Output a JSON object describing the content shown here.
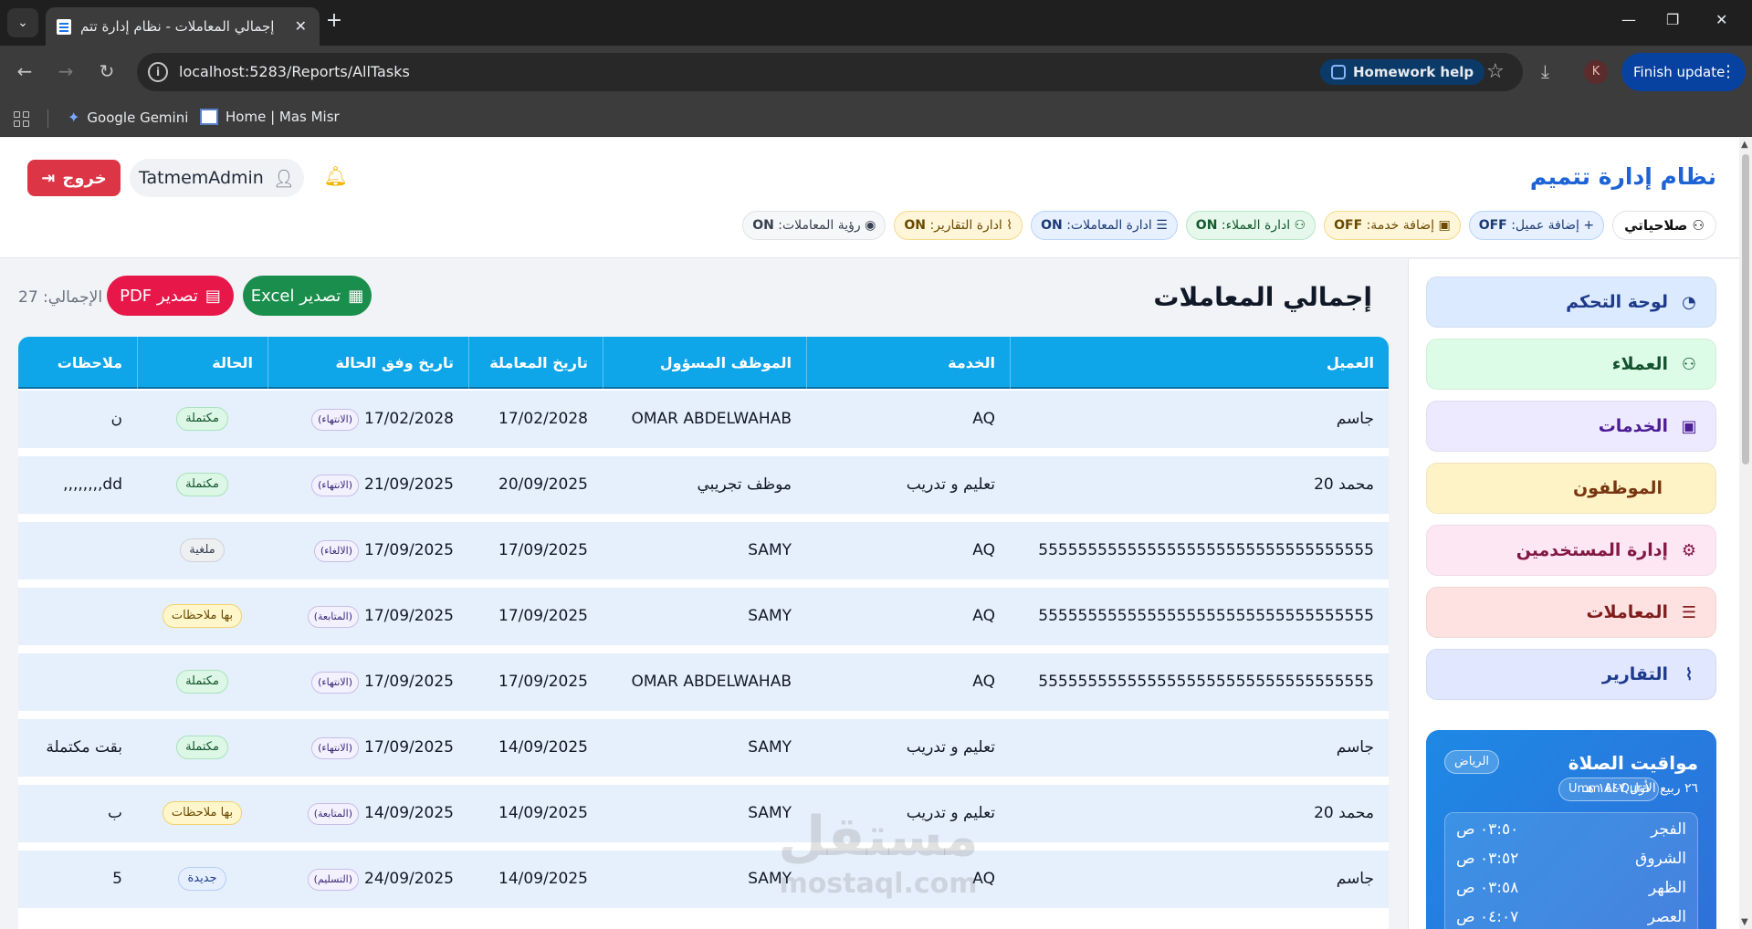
{
  "browser": {
    "tab_title": "إجمالي المعاملات - نظام إدارة تتم",
    "url": "localhost:5283/Reports/AllTasks",
    "homework_help": "Homework help",
    "profile_initial": "K",
    "finish_update": "Finish update",
    "bookmarks": [
      "Google Gemini",
      "Home | Mas Misr"
    ]
  },
  "header": {
    "brand": "نظام إدارة تتميم",
    "logout": "خروج",
    "username": "TatmemAdmin",
    "permissions_label": "صلاحياتي",
    "permissions": [
      {
        "label": "إضافة عميل:",
        "value": "OFF",
        "tone": "blue",
        "icon": "user-plus-icon",
        "glyph": "+"
      },
      {
        "label": "إضافة خدمة:",
        "value": "OFF",
        "tone": "yellow",
        "icon": "briefcase-icon",
        "glyph": "▣"
      },
      {
        "label": "ادارة العملاء:",
        "value": "ON",
        "tone": "green",
        "icon": "users-gear-icon",
        "glyph": "⚇"
      },
      {
        "label": "ادارة المعاملات:",
        "value": "ON",
        "tone": "blue",
        "icon": "list-check-icon",
        "glyph": "☰"
      },
      {
        "label": "ادارة التقارير:",
        "value": "ON",
        "tone": "yellow",
        "icon": "chart-line-icon",
        "glyph": "⌇"
      },
      {
        "label": "رؤية المعاملات:",
        "value": "ON",
        "tone": "white",
        "icon": "eye-icon",
        "glyph": "◉"
      }
    ]
  },
  "sidebar": {
    "items": [
      {
        "label": "لوحة التحكم",
        "icon": "dashboard-icon",
        "glyph": "◔",
        "bg": "#dbeafe",
        "fg": "#1e3a8a"
      },
      {
        "label": "العملاء",
        "icon": "users-icon",
        "glyph": "⚇",
        "bg": "#dcfce7",
        "fg": "#14532d"
      },
      {
        "label": "الخدمات",
        "icon": "briefcase-icon",
        "glyph": "▣",
        "bg": "#ede9fe",
        "fg": "#4c1d95"
      },
      {
        "label": "الموظفون",
        "icon": "",
        "glyph": "",
        "bg": "#fef3c7",
        "fg": "#78350f"
      },
      {
        "label": "إدارة المستخدمين",
        "icon": "user-gear-icon",
        "glyph": "⚙",
        "bg": "#fce7f3",
        "fg": "#831843"
      },
      {
        "label": "المعاملات",
        "icon": "list-check-icon",
        "glyph": "☰",
        "bg": "#fee2e2",
        "fg": "#7f1d1d"
      },
      {
        "label": "التقارير",
        "icon": "chart-line-icon",
        "glyph": "⌇",
        "bg": "#e0e7ff",
        "fg": "#1e3a8a"
      }
    ],
    "prayer": {
      "title": "مواقيت الصلاة",
      "city": "الرياض",
      "date": "٢٦ ربيع الأول ١٤٤٧ هـ",
      "calendar": "Umm Al-Qura",
      "times": [
        {
          "name": "الفجر",
          "time": "٠٣:٥٠ ص"
        },
        {
          "name": "الشروق",
          "time": "٠٣:٥٢ ص"
        },
        {
          "name": "الظهر",
          "time": "٠٣:٥٨ ص"
        },
        {
          "name": "العصر",
          "time": "٠٤:٠٧ ص"
        }
      ]
    }
  },
  "main": {
    "title": "إجمالي المعاملات",
    "total": "الإجمالي: 27",
    "export_pdf": "تصدير PDF",
    "export_excel": "تصدير Excel",
    "columns": [
      "العميل",
      "الخدمة",
      "الموظف المسؤول",
      "تاريخ المعاملة",
      "تاريخ وفق الحالة",
      "الحالة",
      "ملاحظات"
    ],
    "rows": [
      {
        "client": "جاسم",
        "service": "AQ",
        "employee": "OMAR ABDELWAHAB",
        "tx_date": "17/02/2028",
        "state_date": "17/02/2028",
        "state_tag": "(الانتهاء)",
        "status": "مكتملة",
        "status_type": "done",
        "notes": "ن"
      },
      {
        "client": "محمد 20",
        "service": "تعليم و تدريب",
        "employee": "موظف تجريبي",
        "tx_date": "20/09/2025",
        "state_date": "21/09/2025",
        "state_tag": "(الانتهاء)",
        "status": "مكتملة",
        "status_type": "done",
        "notes": "dd,,,,,,,,"
      },
      {
        "client": "5555555555555555555555555555555555",
        "service": "AQ",
        "employee": "SAMY",
        "tx_date": "17/09/2025",
        "state_date": "17/09/2025",
        "state_tag": "(الالغاء)",
        "status": "ملغية",
        "status_type": "cancel",
        "notes": ""
      },
      {
        "client": "5555555555555555555555555555555555",
        "service": "AQ",
        "employee": "SAMY",
        "tx_date": "17/09/2025",
        "state_date": "17/09/2025",
        "state_tag": "(المتابعة)",
        "status": "بها ملاحظات",
        "status_type": "notes",
        "notes": ""
      },
      {
        "client": "5555555555555555555555555555555555",
        "service": "AQ",
        "employee": "OMAR ABDELWAHAB",
        "tx_date": "17/09/2025",
        "state_date": "17/09/2025",
        "state_tag": "(الانتهاء)",
        "status": "مكتملة",
        "status_type": "done",
        "notes": ""
      },
      {
        "client": "جاسم",
        "service": "تعليم و تدريب",
        "employee": "SAMY",
        "tx_date": "14/09/2025",
        "state_date": "17/09/2025",
        "state_tag": "(الانتهاء)",
        "status": "مكتملة",
        "status_type": "done",
        "notes": "بقت مكتملة"
      },
      {
        "client": "محمد 20",
        "service": "تعليم و تدريب",
        "employee": "SAMY",
        "tx_date": "14/09/2025",
        "state_date": "14/09/2025",
        "state_tag": "(المتابعة)",
        "status": "بها ملاحظات",
        "status_type": "notes",
        "notes": "ب"
      },
      {
        "client": "جاسم",
        "service": "AQ",
        "employee": "SAMY",
        "tx_date": "14/09/2025",
        "state_date": "24/09/2025",
        "state_tag": "(التسليم)",
        "status": "جديدة",
        "status_type": "new",
        "notes": "5"
      }
    ]
  },
  "watermark": {
    "ar": "مستقل",
    "en": "mostaql.com"
  }
}
